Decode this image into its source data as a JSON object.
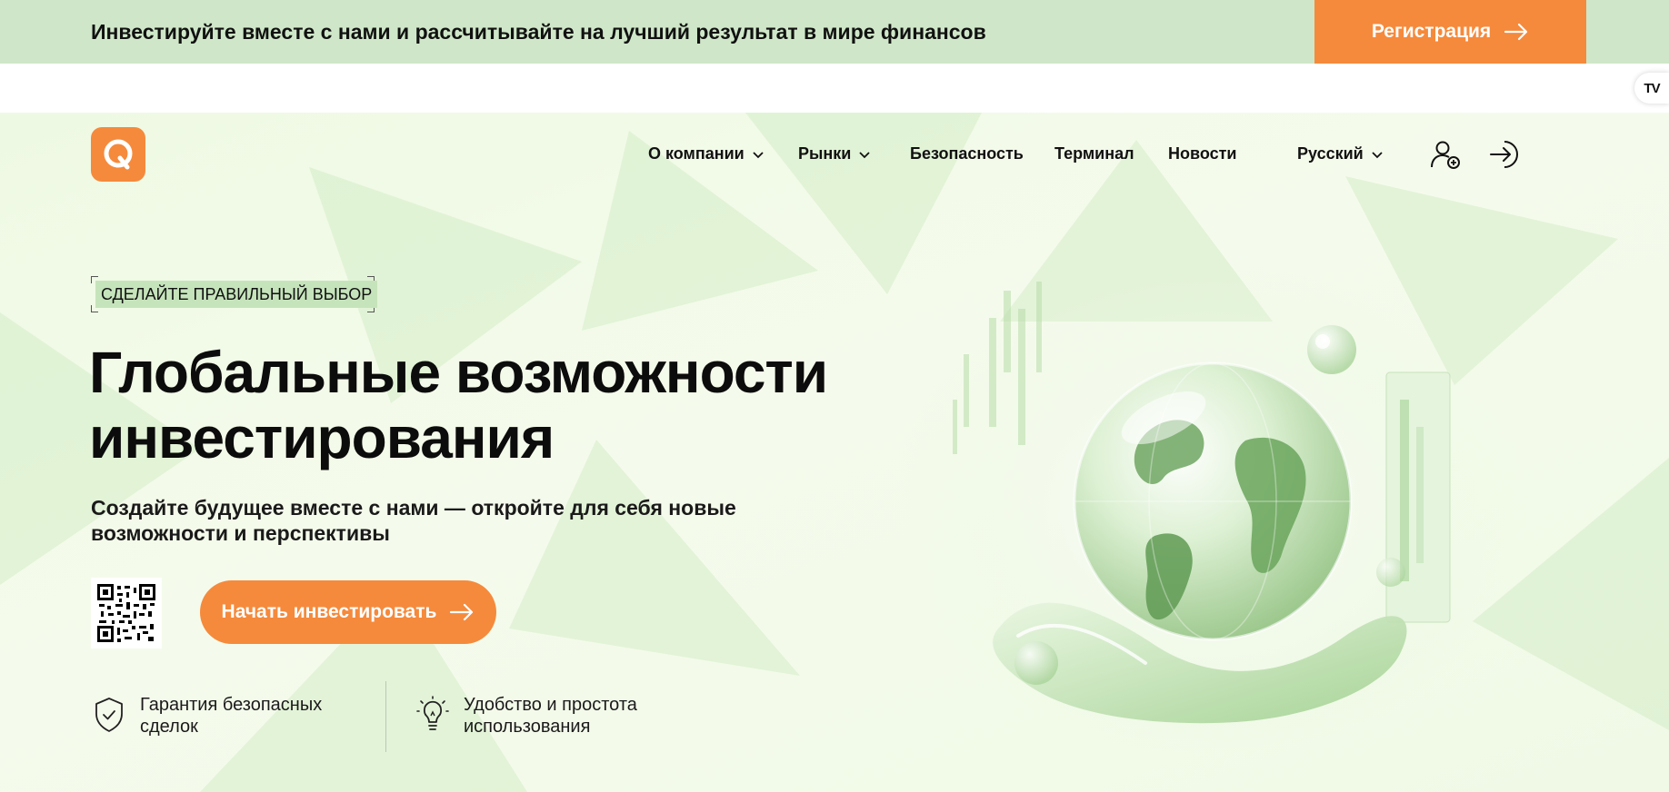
{
  "promo": {
    "text": "Инвестируйте вместе с нами и рассчитывайте на лучший результат в мире финансов",
    "button_label": "Регистрация"
  },
  "badge": {
    "label": "TV"
  },
  "nav": {
    "items": [
      {
        "label": "О компании",
        "has_dropdown": true
      },
      {
        "label": "Рынки",
        "has_dropdown": true
      },
      {
        "label": "Безопасность",
        "has_dropdown": false
      },
      {
        "label": "Терминал",
        "has_dropdown": false
      },
      {
        "label": "Новости",
        "has_dropdown": false
      }
    ],
    "language": "Русский",
    "icons": [
      "user-add-icon",
      "login-icon"
    ]
  },
  "hero": {
    "tagline": "СДЕЛАЙТЕ ПРАВИЛЬНЫЙ ВЫБОР",
    "title_line1": "Глобальные возможности",
    "title_line2": "инвестирования",
    "subtitle_line1": "Создайте будущее вместе с нами — откройте для себя новые",
    "subtitle_line2": "возможности и перспективы",
    "cta_label": "Начать инвестировать"
  },
  "features": [
    {
      "icon": "shield-check-icon",
      "line1": "Гарантия безопасных",
      "line2": "сделок"
    },
    {
      "icon": "lightbulb-icon",
      "line1": "Удобство и простота",
      "line2": "использования"
    }
  ],
  "colors": {
    "accent": "#f58a3c",
    "promo_bg": "#cfe7c8",
    "hero_bg": "#f3fbea",
    "tagline_bg": "#c6e4bb"
  }
}
